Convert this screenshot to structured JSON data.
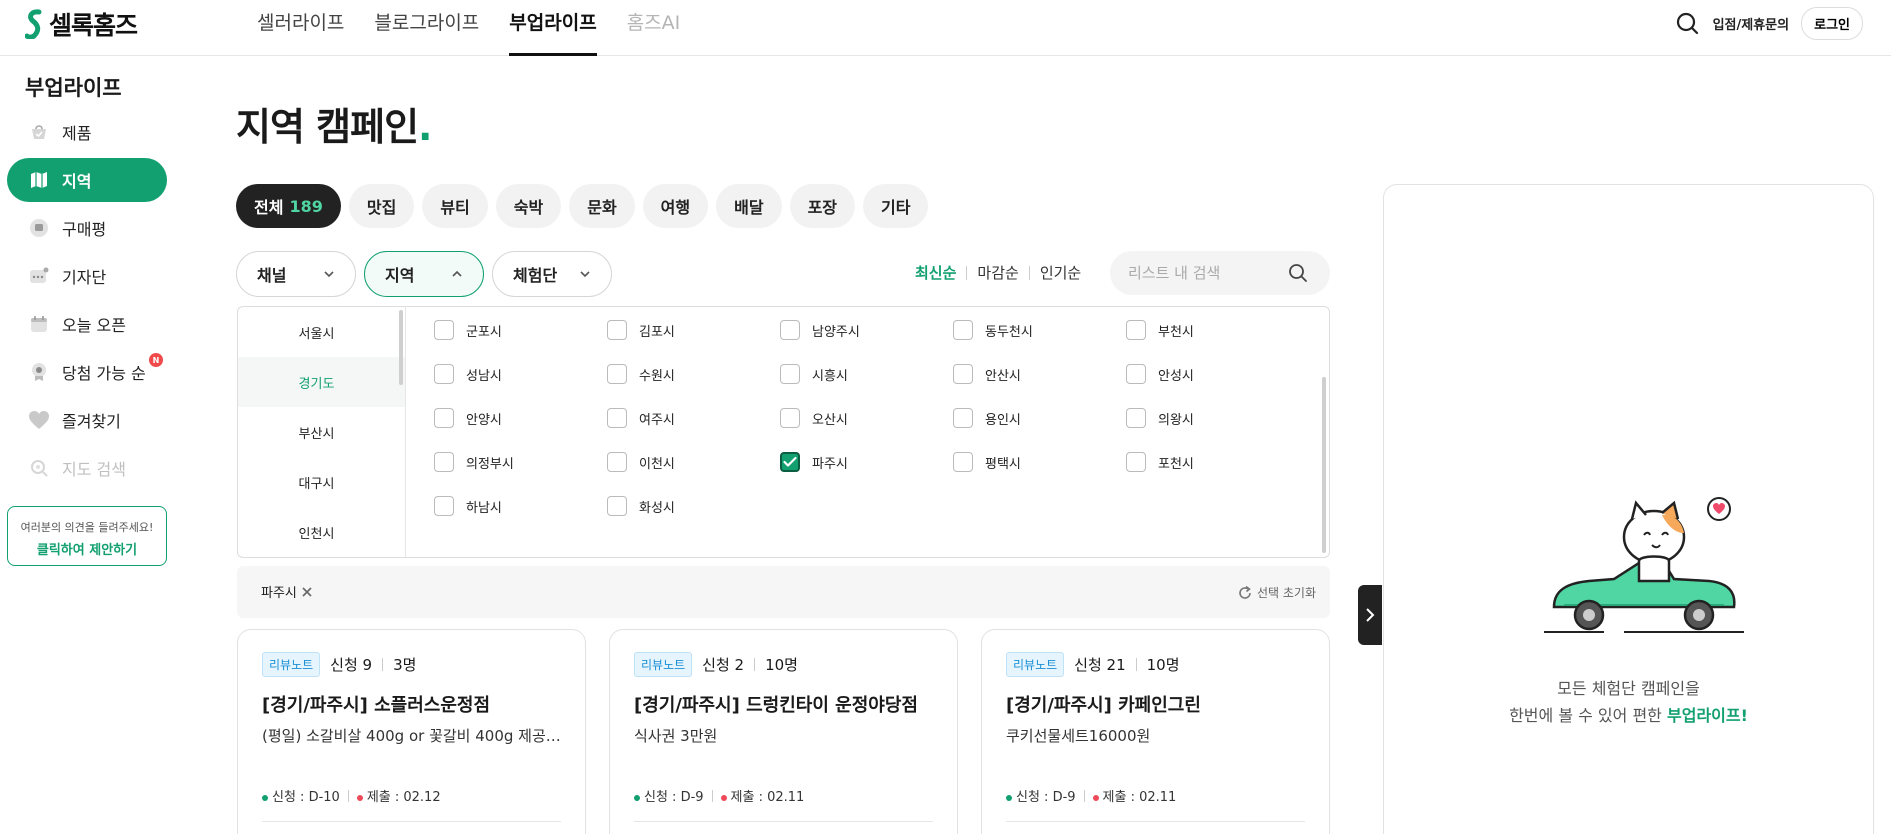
{
  "header": {
    "logo_text": "셀록홈즈",
    "nav": [
      "셀러라이프",
      "블로그라이프",
      "부업라이프",
      "홈즈AI"
    ],
    "active_nav": "부업라이프",
    "partner_link": "입점/제휴문의",
    "login_label": "로그인"
  },
  "sidebar": {
    "title": "부업라이프",
    "items": [
      {
        "label": "제품",
        "icon": "product-icon"
      },
      {
        "label": "지역",
        "icon": "map-icon",
        "active": true
      },
      {
        "label": "구매평",
        "icon": "review-icon"
      },
      {
        "label": "기자단",
        "icon": "reporter-icon"
      },
      {
        "label": "오늘 오픈",
        "icon": "calendar-icon"
      },
      {
        "label": "당첨 가능 순",
        "icon": "badge-icon",
        "badge": "N"
      },
      {
        "label": "즐겨찾기",
        "icon": "heart-icon"
      },
      {
        "label": "지도 검색",
        "icon": "map-search-icon",
        "disabled": true
      }
    ],
    "suggest_line1": "여러분의 의견을 들려주세요!",
    "suggest_line2": "클릭하여 제안하기"
  },
  "main": {
    "title": "지역 캠페인",
    "title_dot": ".",
    "categories": [
      {
        "label": "전체",
        "count": "189"
      },
      {
        "label": "맛집"
      },
      {
        "label": "뷰티"
      },
      {
        "label": "숙박"
      },
      {
        "label": "문화"
      },
      {
        "label": "여행"
      },
      {
        "label": "배달"
      },
      {
        "label": "포장"
      },
      {
        "label": "기타"
      }
    ],
    "filters": [
      "채널",
      "지역",
      "체험단"
    ],
    "sort": [
      "최신순",
      "마감순",
      "인기순"
    ],
    "search_placeholder": "리스트 내 검색",
    "regions": [
      "서울시",
      "경기도",
      "부산시",
      "대구시",
      "인천시"
    ],
    "active_region": "경기도",
    "cities": [
      "군포시",
      "김포시",
      "남양주시",
      "동두천시",
      "부천시",
      "성남시",
      "수원시",
      "시흥시",
      "안산시",
      "안성시",
      "안양시",
      "여주시",
      "오산시",
      "용인시",
      "의왕시",
      "의정부시",
      "이천시",
      "파주시",
      "평택시",
      "포천시",
      "하남시",
      "화성시"
    ],
    "checked_city": "파주시",
    "selected_tag": "파주시",
    "reset_label": "선택 초기화",
    "cards": [
      {
        "badge": "리뷰노트",
        "applied": "신청 9",
        "quota": "3명",
        "title": "[경기/파주시] 소플러스운정점",
        "desc": "(평일) 소갈비살 400g or 꽃갈비 400g 제공 ...",
        "apply": "신청 : D-10",
        "submit": "제출 : 02.12"
      },
      {
        "badge": "리뷰노트",
        "applied": "신청 2",
        "quota": "10명",
        "title": "[경기/파주시] 드렁킨타이 운정야당점",
        "desc": "식사권 3만원",
        "apply": "신청 : D-9",
        "submit": "제출 : 02.11"
      },
      {
        "badge": "리뷰노트",
        "applied": "신청 21",
        "quota": "10명",
        "title": "[경기/파주시] 카페인그린",
        "desc": "쿠키선물세트16000원",
        "apply": "신청 : D-9",
        "submit": "제출 : 02.11"
      }
    ]
  },
  "promo": {
    "line1": "모든 체험단 캠페인을",
    "line2_prefix": "한번에 볼 수 있어 편한 ",
    "line2_brand": "부업라이프!"
  },
  "colors": {
    "accent": "#12a071",
    "dark": "#222222",
    "badge_red": "#f04a4a"
  }
}
